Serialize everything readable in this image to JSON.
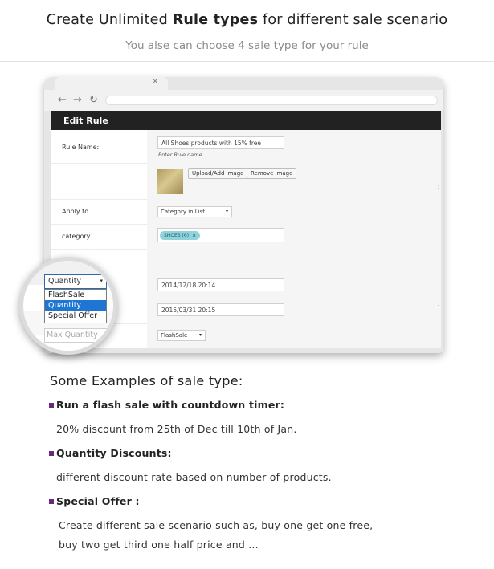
{
  "header": {
    "title_prefix": "Create Unlimited",
    "title_bold": "Rule types",
    "title_suffix": "for different sale scenario",
    "subtitle": "You alse can choose 4 sale type for your rule"
  },
  "browser": {
    "tab_close": "×",
    "nav": {
      "back": "←",
      "forward": "→",
      "reload": "↻"
    }
  },
  "form": {
    "title": "Edit Rule",
    "rule_name_label": "Rule Name:",
    "rule_name_value": "All Shoes products with 15% free",
    "rule_name_hint": "Enter Rule name",
    "upload_button": "Upload/Add image",
    "remove_button": "Remove image",
    "apply_to_label": "Apply to",
    "apply_to_value": "Category in List",
    "category_label": "category",
    "category_tag": "SHOES (6)",
    "tag_remove": "×",
    "start_date": "2014/12/18 20:14",
    "end_date": "2015/03/31 20:15",
    "sale_type_value": "FlashSale",
    "dropdown_arrow": "▾"
  },
  "magnifier": {
    "selected": "Quantity",
    "options": [
      "FlashSale",
      "Quantity",
      "Special Offer"
    ],
    "max_placeholder": "Max Quantity"
  },
  "examples": {
    "title": "Some Examples of sale type:",
    "items": [
      {
        "heading": "Run a flash sale with countdown timer:",
        "body": [
          "20% discount from 25th of Dec till 10th of Jan."
        ]
      },
      {
        "heading": "Quantity Discounts:",
        "body": [
          "different discount rate based on number of products."
        ]
      },
      {
        "heading": "Special Offer :",
        "body": [
          "Create different sale scenario such as, buy one get one free,",
          "buy two get third one half price and ..."
        ]
      }
    ]
  },
  "colors": {
    "bullet": "#6a2a7c",
    "header_bar": "#222222",
    "tag": "#8fd3dd",
    "selected_option": "#1f76d2"
  }
}
